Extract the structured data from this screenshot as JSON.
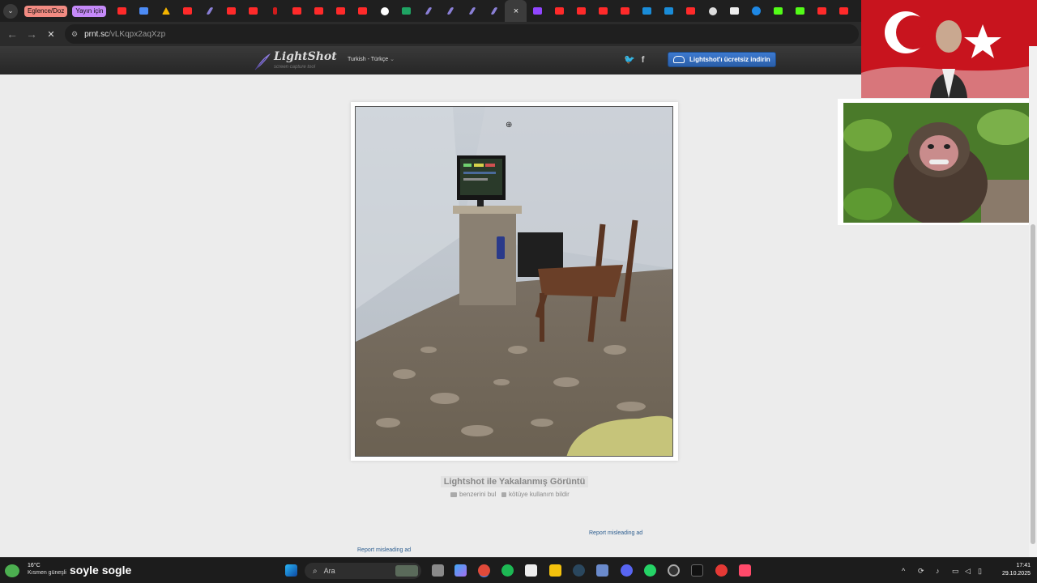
{
  "browser": {
    "tab_groups": [
      {
        "label": "Eglence/Doz",
        "color": "#f28b82"
      },
      {
        "label": "Yayın için",
        "color": "#c58af9"
      }
    ],
    "active_tab_close": "×",
    "address": {
      "host": "prnt.sc",
      "path": "/vLKqpx2aqXzp"
    },
    "nav": {
      "back": "←",
      "forward": "→",
      "stop": "✕"
    }
  },
  "lightshot": {
    "logo_name": "LightShot",
    "logo_tagline": "screen capture tool",
    "language": "Turkish - Türkçe",
    "social": {
      "twitter": "twitter-icon",
      "facebook": "facebook-icon"
    },
    "download_label": "Lightshot'ı ücretsiz indirin",
    "caption_title": "Lightshot ile Yakalanmış Görüntü",
    "find_similar": "benzerini bul",
    "report_abuse": "kötüye kullanım bildir",
    "report_ad_right": "Report misleading ad",
    "report_ad_left": "Report misleading ad"
  },
  "taskbar": {
    "weather_temp": "16°C",
    "weather_desc": "Kısmen güneşli",
    "overlay_text": "soyle sogle",
    "search_placeholder": "Ara",
    "time": "17:41",
    "date": "29.10.2025"
  },
  "colors": {
    "accent_blue": "#2a5ea8",
    "header_dark": "#2b2b2b",
    "page_bg": "#ececec"
  }
}
